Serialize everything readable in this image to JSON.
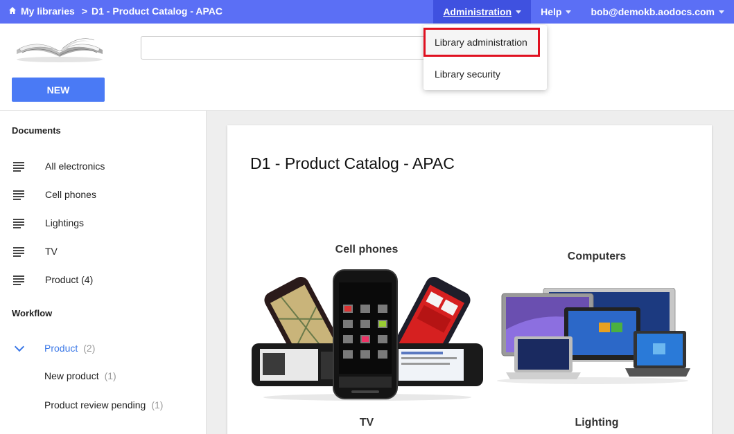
{
  "topbar": {
    "breadcrumb_root": "My libraries",
    "breadcrumb_sep": ">",
    "breadcrumb_current": "D1 - Product Catalog - APAC",
    "admin_label": "Administration",
    "help_label": "Help",
    "user_label": "bob@demokb.aodocs.com"
  },
  "admin_menu": {
    "items": [
      "Library administration",
      "Library security"
    ]
  },
  "search": {
    "value": "",
    "placeholder": ""
  },
  "new_button": "NEW",
  "sidebar": {
    "documents_title": "Documents",
    "documents": [
      "All electronics",
      "Cell phones",
      "Lightings",
      "TV",
      "Product (4)"
    ],
    "workflow_title": "Workflow",
    "workflow": {
      "label": "Product",
      "count": "(2)",
      "states": [
        {
          "label": "New product",
          "count": "(1)"
        },
        {
          "label": "Product review pending",
          "count": "(1)"
        }
      ]
    }
  },
  "main": {
    "title": "D1 - Product Catalog - APAC",
    "tiles": [
      "Cell phones",
      "Computers",
      "TV",
      "Lighting"
    ]
  },
  "colors": {
    "topbar": "#5b6ff5",
    "topbar_active": "#3f51e0",
    "accent_blue": "#3b78e7",
    "new_button": "#4a7af5",
    "highlight_border": "#e01020"
  }
}
